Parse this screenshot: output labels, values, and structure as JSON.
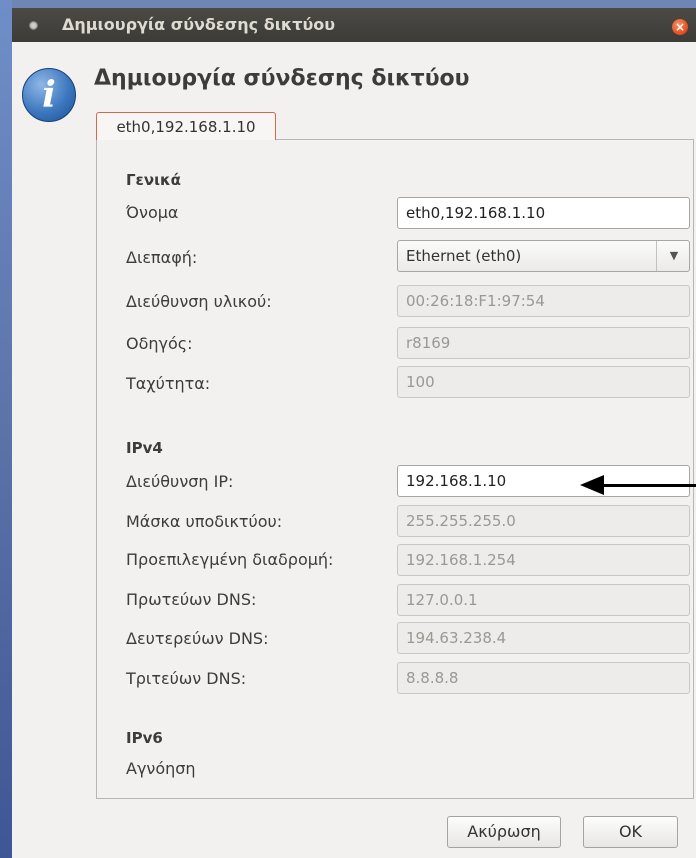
{
  "window": {
    "title": "Δημιουργία σύνδεσης δικτύου",
    "close_icon": "close-icon"
  },
  "dialog": {
    "heading": "Δημιουργία σύνδεσης δικτύου",
    "icon": "info-icon",
    "tab_label": "eth0,192.168.1.10"
  },
  "general": {
    "section_title": "Γενικά",
    "name_label": "Όνομα",
    "name_value": "eth0,192.168.1.10",
    "interface_label": "Διεπαφή:",
    "interface_value": "Ethernet (eth0)",
    "hw_label": "Διεύθυνση υλικού:",
    "hw_value": "00:26:18:F1:97:54",
    "driver_label": "Οδηγός:",
    "driver_value": "r8169",
    "speed_label": "Ταχύτητα:",
    "speed_value": "100"
  },
  "ipv4": {
    "section_title": "IPv4",
    "ip_label": "Διεύθυνση IP:",
    "ip_value": "192.168.1.10",
    "mask_label": "Μάσκα υποδικτύου:",
    "mask_value": "255.255.255.0",
    "gateway_label": "Προεπιλεγμένη διαδρομή:",
    "gateway_value": "192.168.1.254",
    "dns1_label": "Πρωτεύων DNS:",
    "dns1_value": "127.0.0.1",
    "dns2_label": "Δευτερεύων DNS:",
    "dns2_value": "194.63.238.4",
    "dns3_label": "Τριτεύων DNS:",
    "dns3_value": "8.8.8.8"
  },
  "ipv6": {
    "section_title": "IPv6",
    "status": "Αγνόηση"
  },
  "buttons": {
    "cancel_label": "Ακύρωση",
    "ok_label": "OK"
  }
}
